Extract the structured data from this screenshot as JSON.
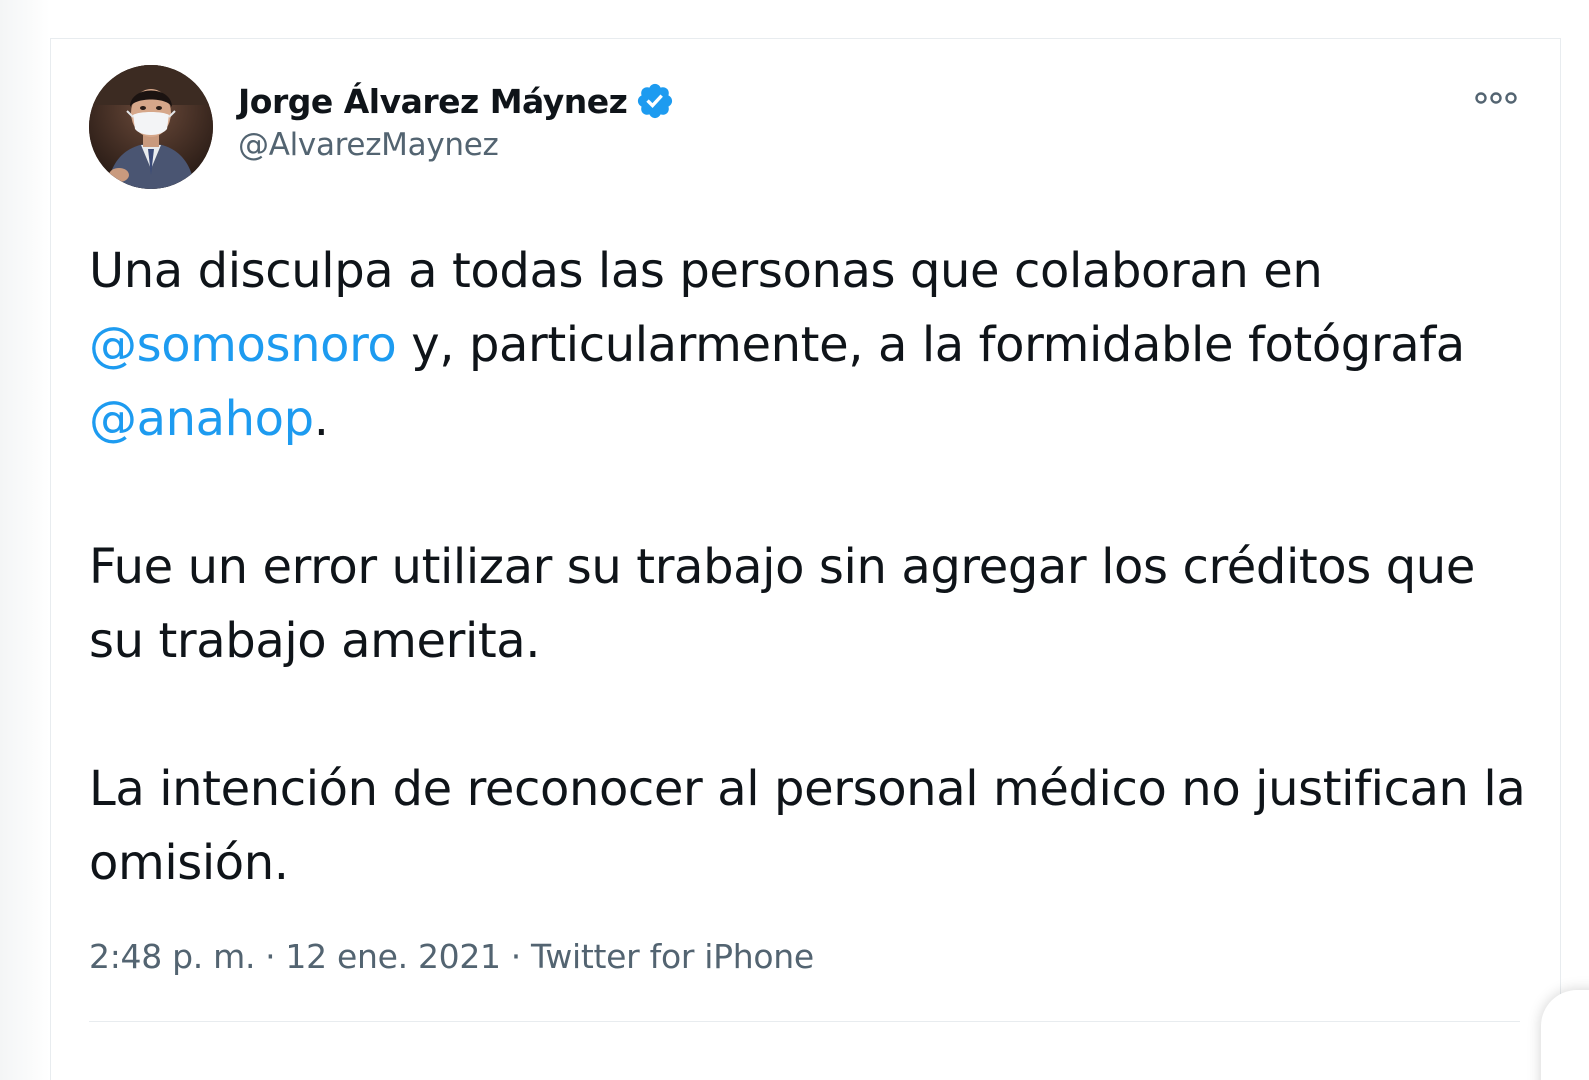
{
  "author": {
    "display_name": "Jorge Álvarez Máynez",
    "handle": "@AlvarezMaynez",
    "verified": true
  },
  "tweet": {
    "paragraphs": [
      [
        {
          "text": "Una disculpa a todas las personas que colaboran en "
        },
        {
          "text": "@somosnoro",
          "mention": true
        },
        {
          "text": " y, particularmente, a la formidable fotógrafa "
        },
        {
          "text": "@anahop",
          "mention": true
        },
        {
          "text": "."
        }
      ],
      [
        {
          "text": "Fue un error utilizar su trabajo sin agregar los créditos que su trabajo amerita."
        }
      ],
      [
        {
          "text": "La intención de reconocer al personal médico no justifican la omisión."
        }
      ]
    ]
  },
  "meta": {
    "time": "2:48 p. m.",
    "separator": "·",
    "date": "12 ene. 2021",
    "source": "Twitter for iPhone"
  },
  "colors": {
    "text": "#0f1419",
    "secondary": "#536471",
    "accent": "#1d9bf0",
    "divider": "#e8ecef"
  },
  "icons": {
    "verified": "verified-badge-icon",
    "more": "more-options-icon"
  }
}
